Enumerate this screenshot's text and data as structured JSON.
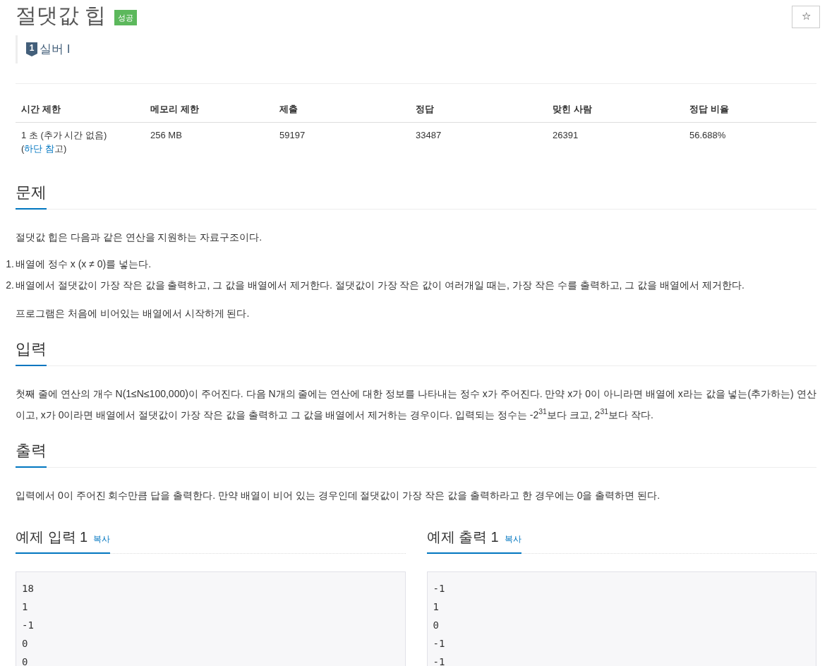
{
  "title": "절댓값 힙",
  "result_badge": "성공",
  "star_button": "☆",
  "tier": {
    "level_mark": "1",
    "label": "실버 I"
  },
  "info_table": {
    "columns": [
      "시간 제한",
      "메모리 제한",
      "제출",
      "정답",
      "맞힌 사람",
      "정답 비율"
    ],
    "row": {
      "time_limit": {
        "text": "1 초 (추가 시간 없음) (",
        "link": "하단 참",
        "suffix": "고)"
      },
      "cells": [
        "256 MB",
        "59197",
        "33487",
        "26391",
        "56.688%"
      ]
    }
  },
  "sections": [
    {
      "heading": "문제",
      "paragraphs": [
        "절댓값 힙은 다음과 같은 연산을 지원하는 자료구조이다."
      ],
      "list": [
        {
          "number": "1.",
          "text": "배열에 정수 x (x ≠ 0)를 넣는다."
        },
        {
          "number": "2.",
          "text": "배열에서 절댓값이 가장 작은 값을 출력하고, 그 값을 배열에서 제거한다. 절댓값이 가장 작은 값이 여러개일 때는, 가장 작은 수를 출력하고, 그 값을 배열에서 제거한다."
        }
      ],
      "after": [
        "프로그램은 처음에 비어있는 배열에서 시작하게 된다."
      ]
    },
    {
      "heading": "입력",
      "paragraphs": [
        "첫째 줄에 연산의 개수 N(1≤N≤100,000)이 주어진다. 다음 N개의 줄에는 연산에 대한 정보를 나타내는 정수 x가 주어진다. 만약 x가 0이 아니라면 배열에 x라는 값을 넣는(추가하는) 연산이고, x가 0이라면 배열에서 절댓값이 가장 작은 값을 출력하고 그 값을 배열에서 제거하는 경우이다. 입력되는 정수는 -2$^{31}$보다 크고, 2$^{31}$보다 작다."
      ]
    },
    {
      "heading": "출력",
      "paragraphs": [
        "입력에서 0이 주어진 회수만큼 답을 출력한다. 만약 배열이 비어 있는 경우인데 절댓값이 가장 작은 값을 출력하라고 한 경우에는 0을 출력하면 된다."
      ]
    }
  ],
  "samples": [
    {
      "heading": "예제 입력 1",
      "copy": "복사",
      "lines": [
        "18",
        "1",
        "-1",
        "0",
        "0"
      ]
    },
    {
      "heading": "예제 출력 1",
      "copy": "복사",
      "lines": [
        "-1",
        "1",
        "0",
        "-1",
        "-1"
      ]
    }
  ]
}
